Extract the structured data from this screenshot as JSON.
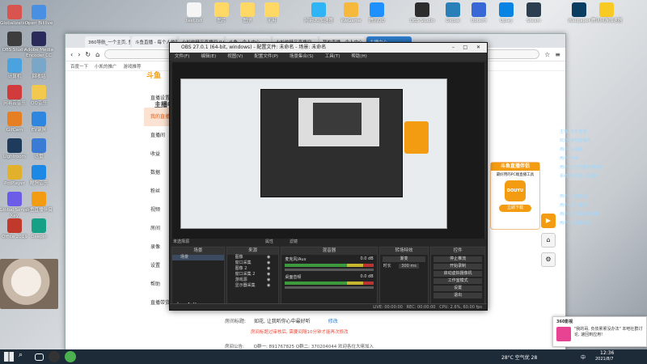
{
  "desktop": {
    "left_icons": [
      {
        "label": "Globalization",
        "color": "#d9534f"
      },
      {
        "label": "Open Bililive",
        "color": "#4a90e2"
      },
      {
        "label": "OBS Studio",
        "color": "#3d3d3d"
      },
      {
        "label": "Adobe Media Encoder CC 2019",
        "color": "#2b2b5b"
      },
      {
        "label": "计算机",
        "color": "#4aa3df"
      },
      {
        "label": "回收站",
        "color": "#7aa7c7"
      },
      {
        "label": "网易云音乐",
        "color": "#d23b3b"
      },
      {
        "label": "QQ音乐",
        "color": "#f2c94c"
      },
      {
        "label": "GifCam",
        "color": "#e67e22"
      },
      {
        "label": "EV录屏",
        "color": "#2e86de"
      },
      {
        "label": "Lightroom",
        "color": "#1f3b5b"
      },
      {
        "label": "迅雷",
        "color": "#3a7bd5"
      },
      {
        "label": "PotPlayer",
        "color": "#e1b12c"
      },
      {
        "label": "酷狗音乐",
        "color": "#1e88e5"
      },
      {
        "label": "Global Server Key",
        "color": "#6c5ce7"
      },
      {
        "label": "斗鱼直播伴侣",
        "color": "#f39c12"
      },
      {
        "label": "Office 2019",
        "color": "#c0392b"
      },
      {
        "label": "Deepin",
        "color": "#16a085"
      }
    ],
    "top_icons": [
      {
        "label": "test.txt",
        "color": "#f5f5f5"
      },
      {
        "label": "图片",
        "color": "#ffd866"
      },
      {
        "label": "图册",
        "color": "#ffd866"
      },
      {
        "label": "无用",
        "color": "#ffd866"
      },
      {
        "label": "网易UU加速器",
        "color": "#2fb5f5"
      },
      {
        "label": "WeGame",
        "color": "#f6b93b"
      },
      {
        "label": "腾讯QQ",
        "color": "#1e90ff"
      },
      {
        "label": "OBS Studio",
        "color": "#2d2d2d"
      },
      {
        "label": "Global",
        "color": "#2980b9"
      },
      {
        "label": "Ubisoft",
        "color": "#3867d6"
      },
      {
        "label": "Uplay",
        "color": "#0984e3"
      },
      {
        "label": "Steam",
        "color": "#2c3e50"
      },
      {
        "label": "Wallpaper",
        "color": "#0a3d62"
      },
      {
        "label": "腾讯网游加速器",
        "color": "#f9ca24"
      }
    ]
  },
  "browser": {
    "tabs": [
      {
        "label": "360导航_一个主页, 整个世界"
      },
      {
        "label": "斗鱼直播 - 每个人的直播平台"
      },
      {
        "label": "小杉的精品直播间 (LOL王者)"
      },
      {
        "label": "斗鱼 - 个人中心"
      },
      {
        "label": "小杉的精品直播间"
      },
      {
        "label": "我的直播 - 个人中心"
      },
      {
        "label": "主播中心"
      }
    ],
    "bookmarks": [
      "百度一下",
      "小凯的推广",
      "游戏推荐"
    ],
    "site_logo": "斗鱼",
    "sidebar": {
      "title": "主播中心",
      "items": [
        "直播设置",
        "我的直播",
        "直播间",
        "收益",
        "数据",
        "粉丝",
        "视频",
        "房间",
        "录像",
        "设置",
        "帮助",
        "直播带货"
      ],
      "highlight_index": 1
    },
    "form": {
      "title_label": "房间标题:",
      "title_value": "如花, 让我听你心中最好听",
      "edit_link": "修改",
      "notice": "房间标题过审核后, 需要间隔10分钟才能再次修改",
      "announce_label": "房间公告:",
      "announce_value": "Q群一: 891767825  Q群二: 370204044 欢迎各位大佬加入"
    },
    "promo": {
      "title": "斗鱼直播伴侣",
      "subtitle": "最好用的PC端直播工具",
      "button": "立即下载",
      "logo_text": "DOUYU"
    }
  },
  "obs": {
    "title": "OBS 27.0.1 (64-bit, windows) - 配置文件: 未命名 - 场景: 未命名",
    "menu": [
      "文件(F)",
      "编辑(E)",
      "视图(V)",
      "配置文件(P)",
      "场景集合(S)",
      "工具(T)",
      "帮助(H)"
    ],
    "no_source": "未选择源",
    "properties": "属性",
    "filters": "滤镜",
    "panels": {
      "scenes": {
        "header": "场景",
        "items": [
          "场景"
        ]
      },
      "sources": {
        "header": "来源",
        "items": [
          "图像",
          "窗口采集",
          "图像 2",
          "窗口采集 2",
          "游戏源",
          "显示器采集"
        ]
      },
      "mixer": {
        "header": "混音器",
        "tracks": [
          {
            "name": "麦克风/Aux",
            "level": "0.0 dB"
          },
          {
            "name": "桌面音频",
            "level": "0.0 dB"
          }
        ]
      },
      "transitions": {
        "header": "转场特效",
        "type": "渐变",
        "duration_label": "时长",
        "duration": "300 ms"
      },
      "controls": {
        "header": "控件",
        "buttons": [
          "停止推流",
          "开始录制",
          "启动虚拟摄像机",
          "工作室模式",
          "设置",
          "退出"
        ]
      }
    },
    "status": {
      "live": "LIVE: 00:00:00",
      "rec": "REC: 00:00:00",
      "cpu": "CPU: 2.6%, 60.00 fps"
    }
  },
  "chat": {
    "right_lines": [
      "主播: 正在连接",
      "欢迎: 来到直播间",
      "用户: 主播好",
      "用户: 666",
      "用户: 正在与服务器连接",
      "系统: 欢迎进入直播间",
      "用户: 主播加油",
      "用户: 正在连接",
      "用户: 正在连接服务器",
      "用户: 主播真厉害"
    ]
  },
  "notification": {
    "app": "360影视",
    "text": "\"我的哥, 负债累累没办法\" 本吧社群讨论, 速回到应用!"
  },
  "taskbar": {
    "weather": "28°C 空气优 28",
    "ime": "中",
    "time": "12:36",
    "date": "2021/8/7"
  },
  "colors": {
    "douyu_orange": "#f39c12",
    "obs_bg": "#2b2b2b",
    "accent_blue": "#2f80d1"
  }
}
